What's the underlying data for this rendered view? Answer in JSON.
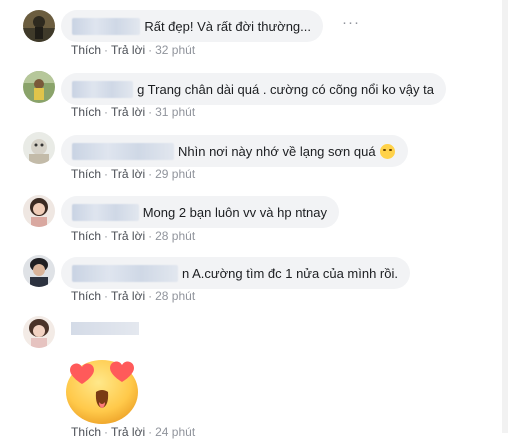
{
  "comments": [
    {
      "name_blurred": true,
      "text": "Rất đẹp! Và rất đời thường...",
      "actions": {
        "like": "Thích",
        "reply": "Trả lời",
        "time": "32 phút"
      }
    },
    {
      "name_blurred": true,
      "text": "g Trang chân dài quá . cường có cõng nổi ko vậy ta",
      "actions": {
        "like": "Thích",
        "reply": "Trả lời",
        "time": "31 phút"
      }
    },
    {
      "name_blurred": true,
      "text": "Nhìn nơi này nhớ về lạng sơn quá",
      "emoji": "sad-face-emoji",
      "actions": {
        "like": "Thích",
        "reply": "Trả lời",
        "time": "29 phút"
      }
    },
    {
      "name_blurred": true,
      "text": "Mong 2 bạn luôn vv và hp ntnay",
      "actions": {
        "like": "Thích",
        "reply": "Trả lời",
        "time": "28 phút"
      }
    },
    {
      "name_blurred": true,
      "text": "n A.cường tìm đc 1 nửa của mình rồi.",
      "actions": {
        "like": "Thích",
        "reply": "Trả lời",
        "time": "28 phút"
      }
    },
    {
      "name_blurred": true,
      "sticker": "heart-eyes-emoji-sticker",
      "actions": {
        "like": "Thích",
        "reply": "Trả lời",
        "time": "24 phút"
      }
    }
  ],
  "menu_icon": "more-options-icon",
  "colors": {
    "bubble": "#f2f3f5",
    "meta": "#90949c",
    "text": "#1c1e21"
  }
}
